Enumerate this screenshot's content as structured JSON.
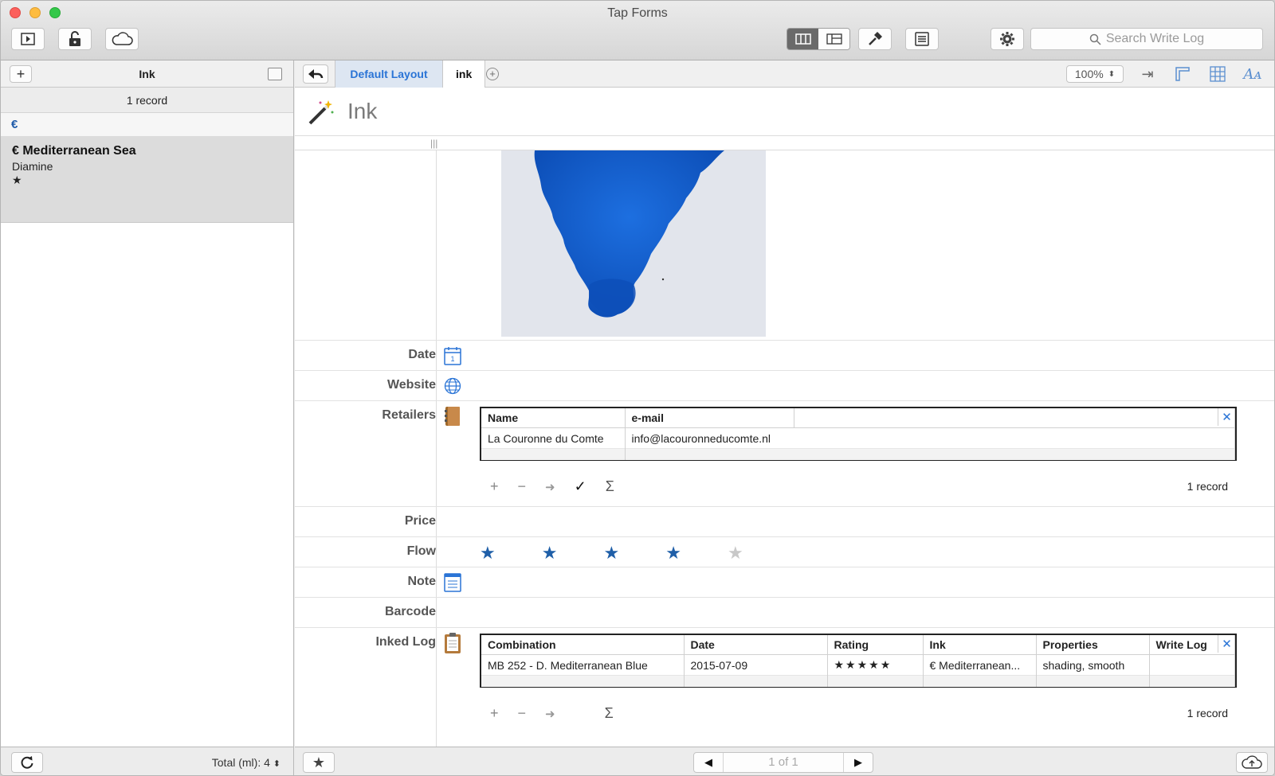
{
  "window": {
    "title": "Tap Forms"
  },
  "toolbar": {
    "search_placeholder": "Search Write Log"
  },
  "sidebar": {
    "title": "Ink",
    "record_count": "1 record",
    "section": "€",
    "records": [
      {
        "name": "€ Mediterranean Sea",
        "subtitle": "Diamine",
        "rating": "★"
      }
    ],
    "total": "Total (ml): 4"
  },
  "tabs": {
    "layout": "Default Layout",
    "form": "ink"
  },
  "zoom": "100%",
  "form": {
    "title": "Ink",
    "fields": {
      "date": "Date",
      "website": "Website",
      "retailers": "Retailers",
      "price": "Price",
      "flow": "Flow",
      "note": "Note",
      "barcode": "Barcode",
      "inked_log": "Inked Log"
    },
    "flow_rating": 4,
    "flow_max": 5
  },
  "retailers_table": {
    "headers": [
      "Name",
      "e-mail"
    ],
    "rows": [
      [
        "La Couronne du Comte",
        "info@lacouronneducomte.nl"
      ]
    ],
    "record_count": "1 record",
    "controls": [
      "+",
      "−",
      "➜",
      "✓",
      "Σ"
    ]
  },
  "inked_log_table": {
    "headers": [
      "Combination",
      "Date",
      "Rating",
      "Ink",
      "Properties",
      "Write Log"
    ],
    "rows": [
      [
        "MB 252 - D. Mediterranean Blue",
        "2015-07-09",
        "★★★★★",
        "€ Mediterranean...",
        "shading, smooth",
        ""
      ]
    ],
    "record_count": "1 record",
    "controls": [
      "+",
      "−",
      "➜",
      "Σ"
    ]
  },
  "pager": {
    "text": "1 of 1"
  },
  "colors": {
    "accent": "#2a74d6",
    "star_on": "#1f5fa8",
    "star_off": "#c8c8c8",
    "ink_blue": "#1a63d4"
  }
}
